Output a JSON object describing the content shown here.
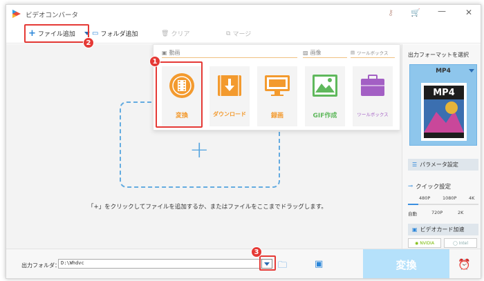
{
  "app": {
    "title": "ビデオコンバータ"
  },
  "toolbar": {
    "add_file": "ファイル追加",
    "add_folder": "フォルダ追加",
    "clear": "クリア",
    "merge": "マージ"
  },
  "categories": {
    "video": "動画",
    "image": "画像",
    "toolbox": "ツールボックス"
  },
  "tools": [
    {
      "label": "変換"
    },
    {
      "label": "ダウンロード"
    },
    {
      "label": "録画"
    },
    {
      "label": "GIF作成"
    },
    {
      "label": "ツールボックス"
    }
  ],
  "main": {
    "hint": "「+」をクリックしてファイルを追加するか、またはファイルをここまでドラッグします。"
  },
  "right": {
    "title": "出力フォーマットを選択",
    "format": "MP4",
    "format_icon_text": "MP4",
    "param_settings": "パラメータ設定",
    "quick_settings": "クイック設定",
    "scale_top": [
      "480P",
      "1080P",
      "4K"
    ],
    "scale_bottom": [
      "自動",
      "720P",
      "2K"
    ],
    "gpu_accel": "ビデオカード加速",
    "gpu_nvidia": "NVIDIA",
    "gpu_intel": "Intel"
  },
  "bottom": {
    "output_label": "出力フォルダ：",
    "output_path": "D:\\Whdvc",
    "convert": "変換"
  },
  "annotations": [
    "1",
    "2",
    "3"
  ],
  "colors": {
    "accent_orange": "#f39a2e",
    "convert_bg": "#b5e1fb",
    "format_bg": "#8ec6ec",
    "annotation_red": "#e53935",
    "dash_blue": "#63abe0"
  }
}
